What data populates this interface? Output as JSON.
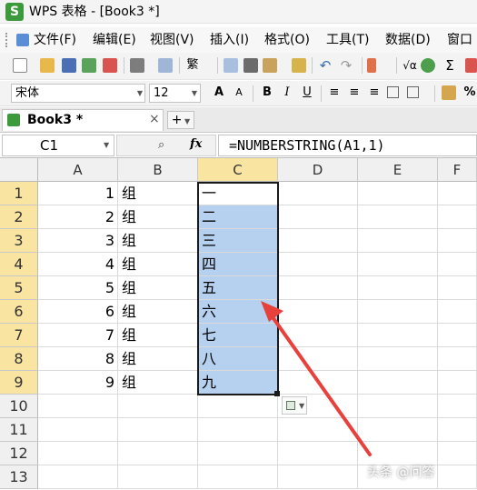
{
  "window": {
    "title": "WPS 表格 - [Book3 *]",
    "logo_letter": "S"
  },
  "menu": [
    "文件(F)",
    "编辑(E)",
    "视图(V)",
    "插入(I)",
    "格式(O)",
    "工具(T)",
    "数据(D)",
    "窗口"
  ],
  "toolbar2": {
    "font_name": "宋体",
    "font_size": "12",
    "bold": "B",
    "italic": "I",
    "underline": "U",
    "grow_font": "A",
    "shrink_font": "A",
    "percent": "%"
  },
  "toolbar1": {
    "sum": "Σ",
    "sqrt": "√α",
    "ime": "繁"
  },
  "tab": {
    "label": "Book3 *",
    "close": "×",
    "new": "+"
  },
  "formula_bar": {
    "name_box": "C1",
    "fx": "fx",
    "formula": "=NUMBERSTRING(A1,1)"
  },
  "columns": [
    "A",
    "B",
    "C",
    "D",
    "E",
    "F"
  ],
  "rows": [
    "1",
    "2",
    "3",
    "4",
    "5",
    "6",
    "7",
    "8",
    "9",
    "10",
    "11",
    "12",
    "13"
  ],
  "col_a": [
    "1",
    "2",
    "3",
    "4",
    "5",
    "6",
    "7",
    "8",
    "9"
  ],
  "col_b": [
    "组",
    "组",
    "组",
    "组",
    "组",
    "组",
    "组",
    "组",
    "组"
  ],
  "col_c": [
    "一",
    "二",
    "三",
    "四",
    "五",
    "六",
    "七",
    "八",
    "九"
  ],
  "selection": {
    "range": "C1:C9",
    "active_cell": "C1"
  },
  "colors": {
    "selection_fill": "#b5d1ef",
    "header_highlight": "#f9e4a1",
    "annotation_arrow": "#e8413c"
  },
  "watermark": "头条 @问答"
}
